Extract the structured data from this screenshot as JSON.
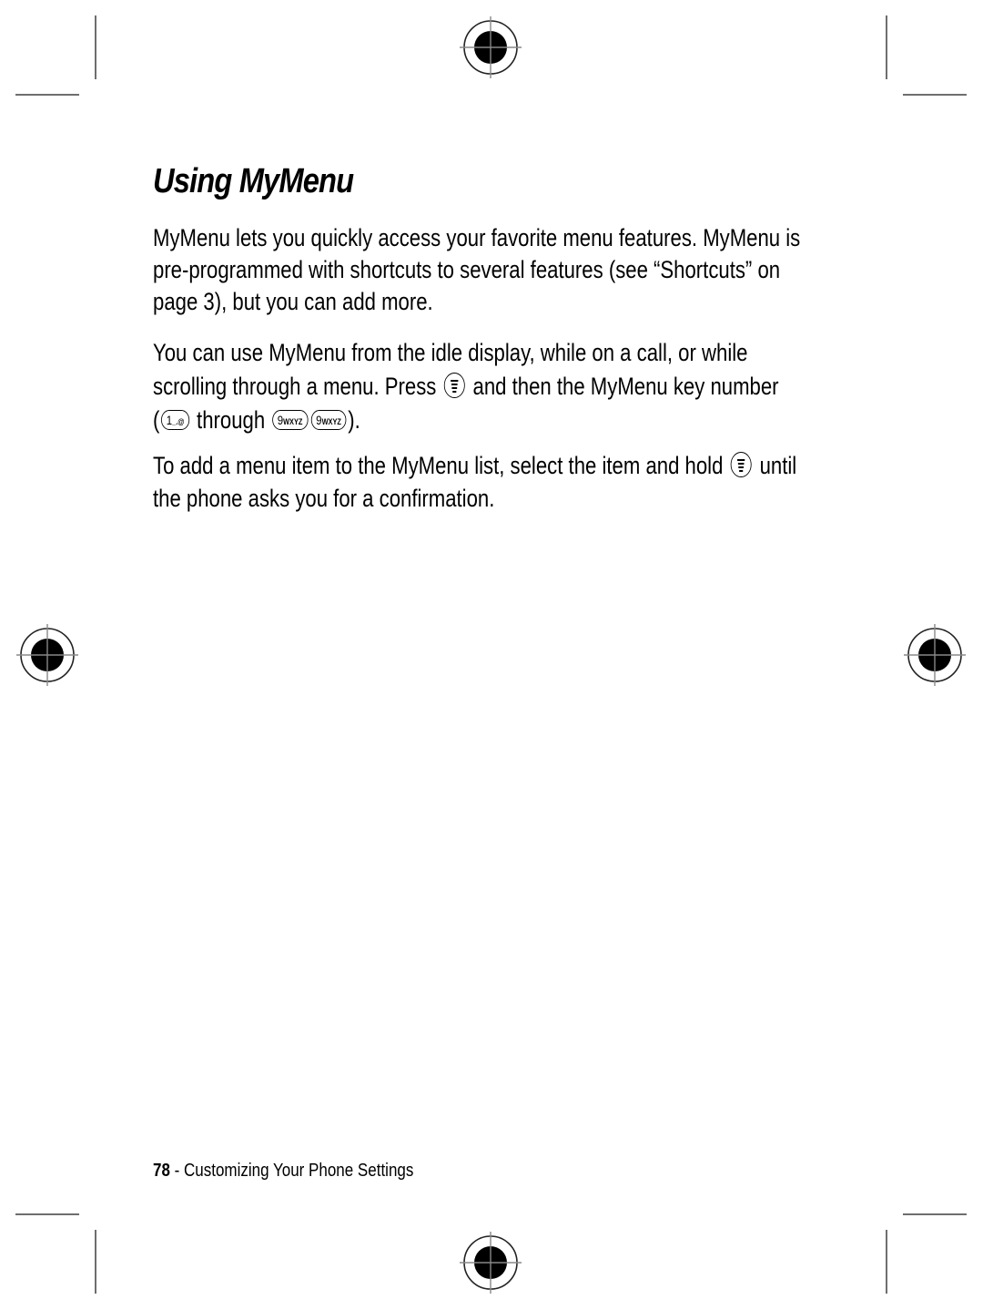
{
  "page": {
    "title": "Using MyMenu",
    "paragraphs": {
      "p1": {
        "line1": "MyMenu lets you quickly access your favorite menu features. MyMenu is",
        "line2": "pre-programmed with shortcuts to several features (see “Shortcuts” on",
        "line3": "page 3), but you can add more."
      },
      "p2": {
        "line1": "You can use MyMenu from the idle display, while on a call, or while",
        "line2_before_key": "scrolling through a menu. Press",
        "line2_after_key": "and then the MyMenu key number",
        "line3_open": "(",
        "line3_through": "through",
        "line3_close": ")."
      },
      "p3": {
        "line1_before_key": "To add a menu item to the MyMenu list, select the item and hold",
        "line1_after_key": "until",
        "line2": "the phone asks you for a confirmation."
      }
    },
    "keys": {
      "key_1": {
        "digit": "1",
        "letters": "_.@"
      },
      "key_9": {
        "digit": "9",
        "letters": "WXYZ"
      },
      "menu_key": "menu-key-icon"
    },
    "footer": {
      "page_number": "78",
      "separator": " - ",
      "section": "Customizing Your Phone Settings"
    }
  }
}
